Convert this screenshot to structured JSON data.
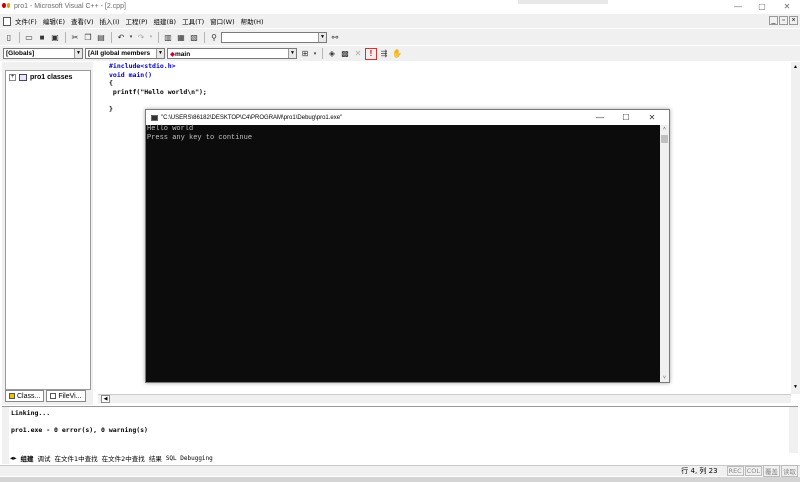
{
  "window": {
    "title": "pro1 - Microsoft Visual C++ - [2.cpp]"
  },
  "menu": [
    "文件(F)",
    "编辑(E)",
    "查看(V)",
    "插入(I)",
    "工程(P)",
    "组建(B)",
    "工具(T)",
    "窗口(W)",
    "帮助(H)"
  ],
  "toolbar2": {
    "scope_combo": "[Globals]",
    "members_combo": "[All global members",
    "function_combo": "main"
  },
  "workspace": {
    "tree_root": "pro1 classes",
    "tabs": [
      "Class...",
      "FileVi..."
    ]
  },
  "editor": {
    "lines": [
      "#include<stdio.h>",
      "void main()",
      "{",
      " printf(\"Hello world\\n\");",
      "",
      "}"
    ]
  },
  "console": {
    "title": "\"C:\\USERS\\86182\\DESKTOP\\C4\\PROGRAM\\pro1\\Debug\\pro1.exe\"",
    "lines": [
      "Hello world",
      "Press any key to continue"
    ]
  },
  "output": {
    "lines": [
      "Linking...",
      "",
      "pro1.exe - 0 error(s), 0 warning(s)"
    ],
    "tabs": [
      "组建",
      "调试",
      "在文件1中查找",
      "在文件2中查找",
      "结果",
      "SQL Debugging"
    ],
    "active_tab": "组建"
  },
  "status": {
    "position": "行 4, 列 23",
    "indicators": [
      "REC",
      "COL",
      "覆盖",
      "读取"
    ]
  },
  "colors": {
    "keyword": "#0000c8",
    "highlight_button_border": "#d93030",
    "console_bg": "#0c0c0c"
  }
}
